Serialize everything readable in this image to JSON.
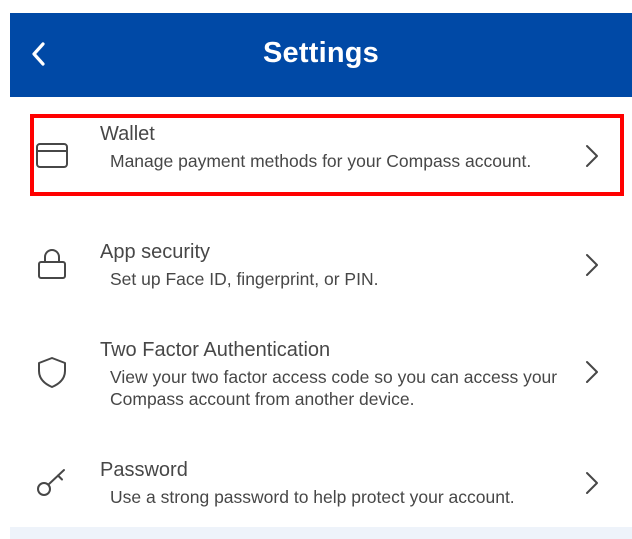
{
  "header": {
    "title": "Settings",
    "back_icon": "chevron-left-icon",
    "background": "#0049a6"
  },
  "items": [
    {
      "title": "Wallet",
      "description": "Manage payment methods for your Compass account.",
      "icon": "credit-card-icon",
      "highlighted": true
    },
    {
      "title": "App security",
      "description": "Set up Face ID, fingerprint, or PIN.",
      "icon": "lock-icon",
      "highlighted": false
    },
    {
      "title": "Two Factor Authentication",
      "description": "View your two factor access code so you can access your Compass account from another device.",
      "icon": "shield-icon",
      "highlighted": false
    },
    {
      "title": "Password",
      "description": "Use a strong password to help protect your account.",
      "icon": "key-icon",
      "highlighted": false
    }
  ],
  "colors": {
    "highlight_border": "#ff0000",
    "text": "#474747"
  }
}
